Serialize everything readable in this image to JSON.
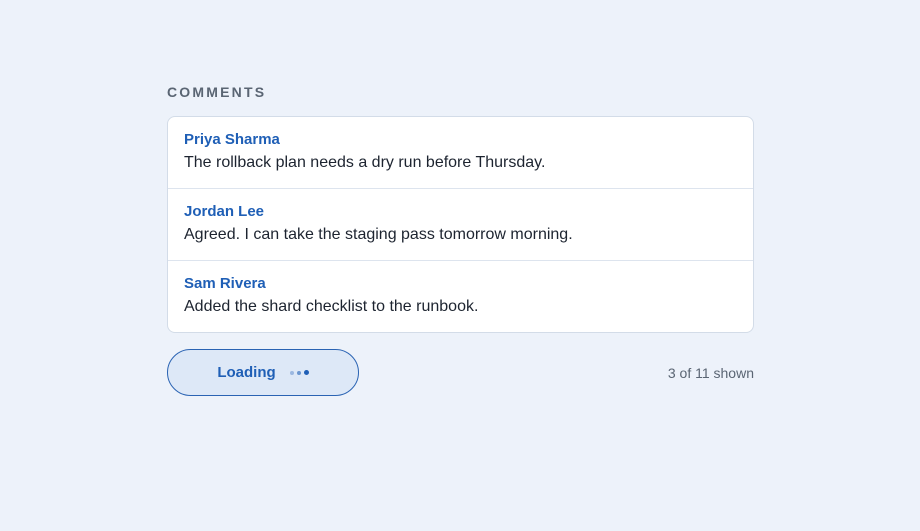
{
  "comments_section": {
    "title": "COMMENTS",
    "items": [
      {
        "author": "Priya Sharma",
        "text": "The rollback plan needs a dry run before Thursday."
      },
      {
        "author": "Jordan Lee",
        "text": "Agreed. I can take the staging pass tomorrow morning."
      },
      {
        "author": "Sam Rivera",
        "text": "Added the shard checklist to the runbook."
      }
    ]
  },
  "footer": {
    "load_button_label": "Loading",
    "load_button_icon": "loading-dots-icon",
    "count_text": "3 of 11 shown"
  },
  "colors": {
    "background": "#edf2fa",
    "accent": "#1f5fb6",
    "button_fill": "#dde8f7"
  }
}
